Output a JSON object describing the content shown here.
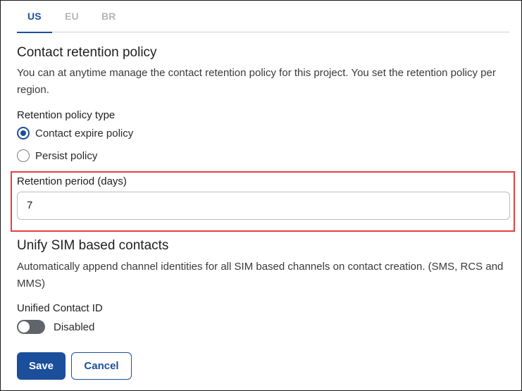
{
  "tabs": [
    {
      "label": "US",
      "active": true
    },
    {
      "label": "EU",
      "active": false
    },
    {
      "label": "BR",
      "active": false
    }
  ],
  "retention": {
    "title": "Contact retention policy",
    "description": "You can at anytime manage the contact retention policy for this project. You set the retention policy per region.",
    "policy_type_label": "Retention policy type",
    "options": [
      {
        "label": "Contact expire policy",
        "checked": true
      },
      {
        "label": "Persist policy",
        "checked": false
      }
    ],
    "period_label": "Retention period (days)",
    "period_value": "7"
  },
  "unify": {
    "title": "Unify SIM based contacts",
    "description": "Automatically append channel identities for all SIM based channels on contact creation. (SMS, RCS and MMS)",
    "unified_label": "Unified Contact ID",
    "toggle_state": "Disabled"
  },
  "actions": {
    "save_label": "Save",
    "cancel_label": "Cancel"
  },
  "colors": {
    "accent": "#1b4f9c",
    "highlight": "#e2403f"
  }
}
